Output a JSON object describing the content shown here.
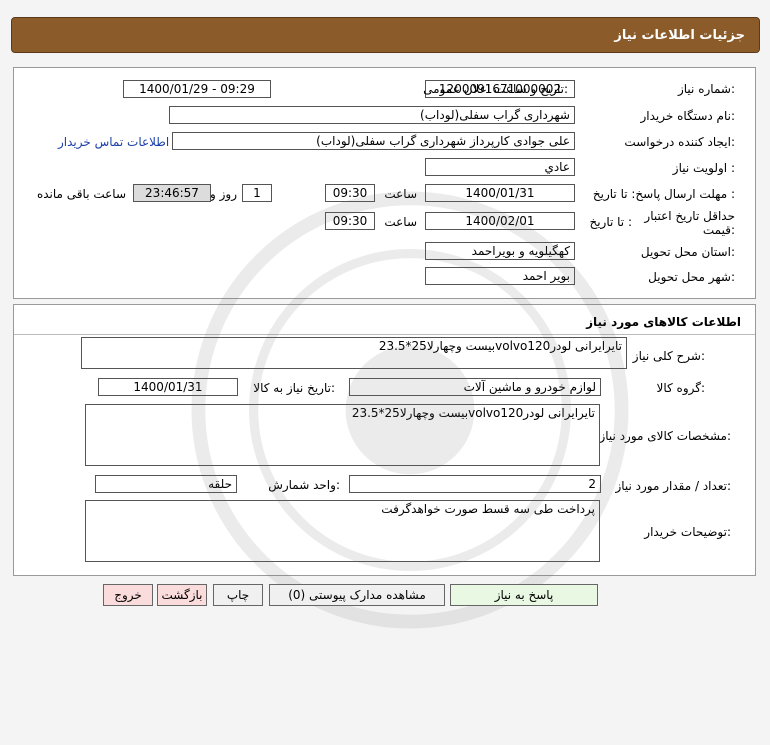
{
  "page_title": "جزئیات اطلاعات نیاز",
  "need_info": {
    "need_number_label": "شماره نیاز:",
    "need_number": "1200091671000002",
    "announce_label": "تاریخ و ساعت اعلان عمومی:",
    "announce_value": "1400/01/29 - 09:29",
    "buyer_org_label": "نام دستگاه خریدار:",
    "buyer_org": "شهرداری گراب سفلی(لوداب)",
    "requester_label": "ایجاد کننده درخواست:",
    "requester": "علی جوادی کارپرداز شهرداری گراب سفلی(لوداب)",
    "contact_link": "اطلاعات تماس خریدار",
    "priority_label": "اولویت نیاز :",
    "priority": "عادي",
    "deadline_label": "مهلت ارسال پاسخ:  تا تاریخ :",
    "deadline_date": "1400/01/31",
    "time_label": "ساعت",
    "deadline_time": "09:30",
    "days_count": "1",
    "days_label": "روز و",
    "remaining_time": "23:46:57",
    "remaining_label": "ساعت باقی مانده",
    "validity_label": "حداقل تاریخ اعتبار قیمت:",
    "validity_to_label": "تا تاریخ :",
    "validity_date": "1400/02/01",
    "validity_time_label": "ساعت",
    "validity_time": "09:30",
    "province_label": "استان محل تحویل:",
    "province": "کهگیلویه و بویراحمد",
    "city_label": "شهر محل تحویل:",
    "city": "بویر احمد"
  },
  "goods": {
    "section_title": "اطلاعات کالاهای مورد نیاز",
    "summary_label": "شرح کلی نیاز:",
    "summary": "تایرایرانی لودرvolvo120بیست وچهارلا25*23.5",
    "group_label": "گروه کالا:",
    "group": "لوازم خودرو و ماشین آلات",
    "need_date_label": "تاریخ نیاز به کالا:",
    "need_date": "1400/01/31",
    "specs_label": "مشخصات کالای مورد نیاز:",
    "specs": "تایرایرانی لودرvolvo120بیست وچهارلا25*23.5",
    "qty_label": "تعداد / مقدار مورد نیاز:",
    "qty": "2",
    "unit_label": "واحد شمارش:",
    "unit": "حلقه",
    "buyer_notes_label": "توضیحات خریدار:",
    "buyer_notes": "پرداخت طی سه قسط صورت خواهدگرفت"
  },
  "actions": {
    "reply": "پاسخ به نیاز",
    "view_docs": "مشاهده مدارک پیوستی (0)",
    "print": "چاپ",
    "back": "بازگشت",
    "exit": "خروج"
  }
}
